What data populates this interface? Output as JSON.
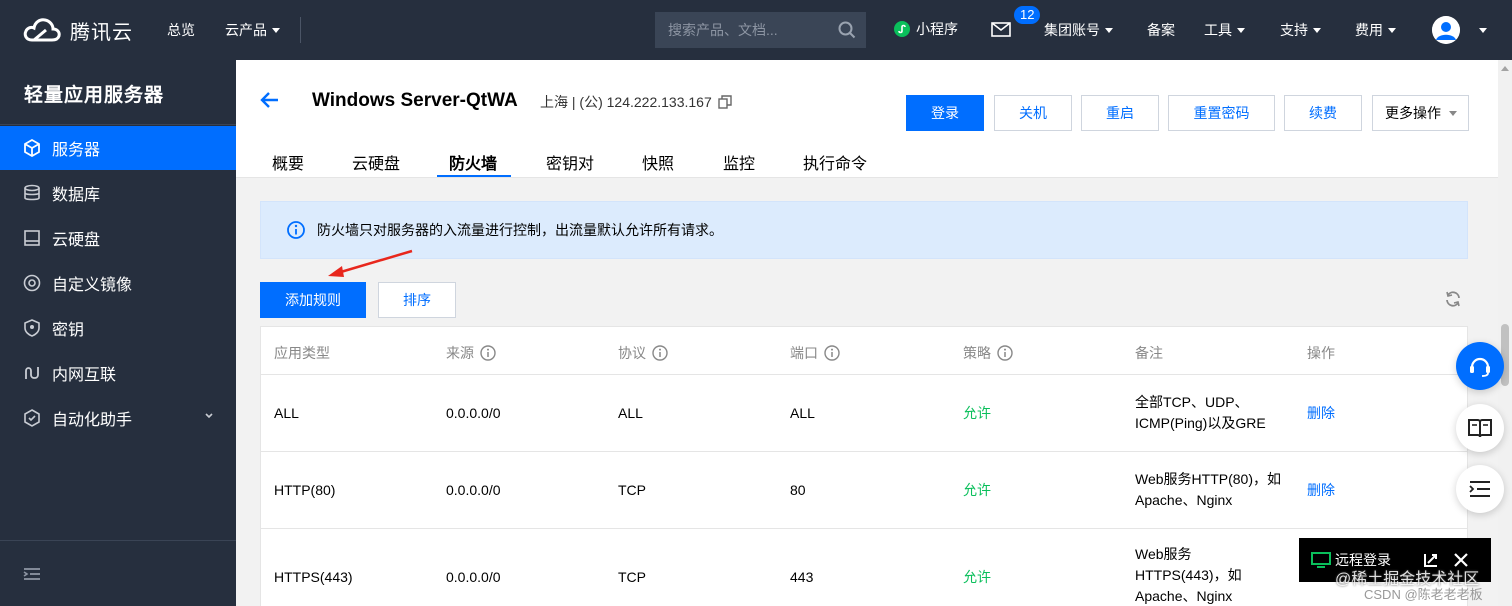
{
  "topbar": {
    "brand": "腾讯云",
    "nav": [
      "总览",
      "云产品"
    ],
    "search_placeholder": "搜索产品、文档...",
    "mini_program": "小程序",
    "message_count": "12",
    "links": [
      "集团账号",
      "备案",
      "工具",
      "支持",
      "费用"
    ]
  },
  "sidebar": {
    "title": "轻量应用服务器",
    "items": [
      {
        "label": "服务器",
        "icon": "cube-icon"
      },
      {
        "label": "数据库",
        "icon": "database-icon"
      },
      {
        "label": "云硬盘",
        "icon": "disk-icon"
      },
      {
        "label": "自定义镜像",
        "icon": "image-icon"
      },
      {
        "label": "密钥",
        "icon": "key-icon"
      },
      {
        "label": "内网互联",
        "icon": "link-icon"
      },
      {
        "label": "自动化助手",
        "icon": "automation-icon"
      }
    ]
  },
  "server": {
    "name": "Windows Server-QtWA",
    "meta": "上海 | (公) 124.222.133.167"
  },
  "header_buttons": {
    "login": "登录",
    "shutdown": "关机",
    "restart": "重启",
    "reset_password": "重置密码",
    "renew": "续费",
    "more": "更多操作"
  },
  "tabs": [
    "概要",
    "云硬盘",
    "防火墙",
    "密钥对",
    "快照",
    "监控",
    "执行命令"
  ],
  "firewall": {
    "notice": "防火墙只对服务器的入流量进行控制，出流量默认允许所有请求。",
    "add_rule": "添加规则",
    "sort": "排序",
    "columns": [
      "应用类型",
      "来源",
      "协议",
      "端口",
      "策略",
      "备注",
      "操作"
    ],
    "rows": [
      {
        "app": "ALL",
        "source": "0.0.0.0/0",
        "protocol": "ALL",
        "port": "ALL",
        "policy": "允许",
        "note": [
          "全部TCP、UDP、",
          "ICMP(Ping)以及GRE"
        ],
        "action": "删除"
      },
      {
        "app": "HTTP(80)",
        "source": "0.0.0.0/0",
        "protocol": "TCP",
        "port": "80",
        "policy": "允许",
        "note": [
          "Web服务HTTP(80)，如",
          "Apache、Nginx"
        ],
        "action": "删除"
      },
      {
        "app": "HTTPS(443)",
        "source": "0.0.0.0/0",
        "protocol": "TCP",
        "port": "443",
        "policy": "允许",
        "note": [
          "Web服务",
          "HTTPS(443)，如",
          "Apache、Nginx"
        ],
        "action": ""
      }
    ]
  },
  "remote_login": "远程登录",
  "watermark": "@稀土掘金技术社区",
  "csdn": "CSDN @陈老老老板",
  "colors": {
    "primary": "#006eff",
    "allow": "#0abf5b",
    "dark": "#262f3e"
  }
}
